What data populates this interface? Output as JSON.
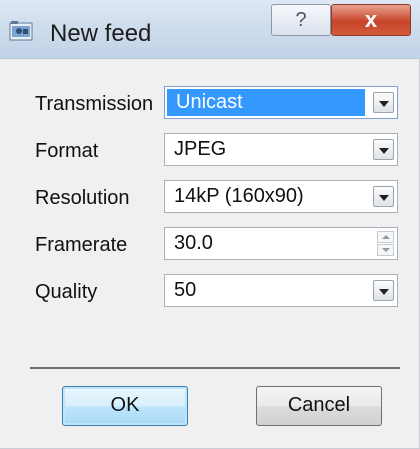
{
  "window": {
    "title": "New feed",
    "help_label": "?",
    "close_label": "x"
  },
  "form": {
    "transmission": {
      "label": "Transmission",
      "value": "Unicast"
    },
    "format": {
      "label": "Format",
      "value": "JPEG"
    },
    "resolution": {
      "label": "Resolution",
      "value": "14kP (160x90)"
    },
    "framerate": {
      "label": "Framerate",
      "value": "30.0"
    },
    "quality": {
      "label": "Quality",
      "value": "50"
    }
  },
  "buttons": {
    "ok_label": "OK",
    "cancel_label": "Cancel"
  },
  "colors": {
    "selection": "#3399ff",
    "close_button": "#c7452a",
    "default_button": "#bee6fd"
  }
}
